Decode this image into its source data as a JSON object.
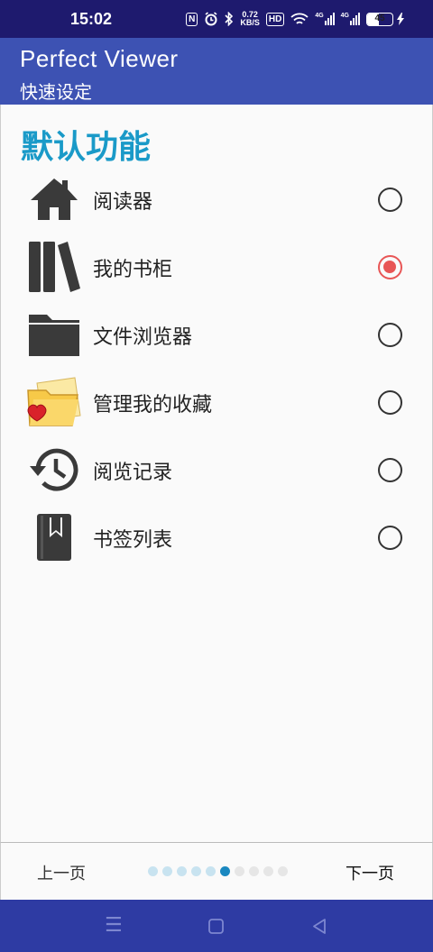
{
  "status_bar": {
    "time": "15:02",
    "nfc": "N",
    "net_speed_value": "0.72",
    "net_speed_unit": "KB/S",
    "hd": "HD",
    "signal1": "4G",
    "signal2": "4G",
    "battery": "45",
    "battery_level": 0.45
  },
  "app_bar": {
    "title": "Perfect Viewer",
    "subtitle": "快速设定"
  },
  "section": {
    "title": "默认功能"
  },
  "options": [
    {
      "label": "阅读器",
      "icon": "home-icon",
      "selected": false
    },
    {
      "label": "我的书柜",
      "icon": "bookshelf-icon",
      "selected": true
    },
    {
      "label": "文件浏览器",
      "icon": "folder-icon",
      "selected": false
    },
    {
      "label": "管理我的收藏",
      "icon": "favorites-folder-icon",
      "selected": false
    },
    {
      "label": "阅览记录",
      "icon": "history-icon",
      "selected": false
    },
    {
      "label": "书签列表",
      "icon": "bookmark-book-icon",
      "selected": false
    }
  ],
  "footer": {
    "prev": "上一页",
    "next": "下一页",
    "page_current": 6,
    "page_total": 10
  },
  "colors": {
    "status_bar": "#1e1a6e",
    "app_bar": "#3d52b3",
    "accent_title": "#1a9ac8",
    "radio_selected": "#e85656",
    "nav_bar": "#2e3ba3"
  }
}
